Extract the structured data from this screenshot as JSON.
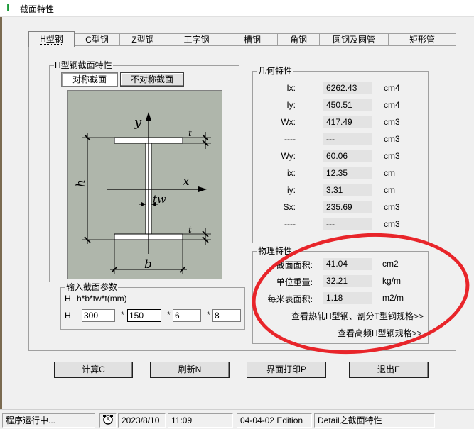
{
  "window": {
    "title": "截面特性",
    "app_icon_glyph": "I"
  },
  "tabs": [
    {
      "label": "H型钢",
      "active": true
    },
    {
      "label": "C型钢"
    },
    {
      "label": "Z型钢"
    },
    {
      "label": "工字钢"
    },
    {
      "label": "槽钢"
    },
    {
      "label": "角钢"
    },
    {
      "label": "圆钢及圆管"
    },
    {
      "label": "矩形管"
    }
  ],
  "h_section": {
    "group_title": "H型钢截面特性",
    "sym_button": "对称截面",
    "asym_button": "不对称截面",
    "figure_labels": {
      "y": "y",
      "x": "x",
      "h": "h",
      "b": "b",
      "t": "t",
      "tw": "tw"
    }
  },
  "input_params": {
    "group_title": "输入截面参数",
    "formula_prefix": "H",
    "formula": "h*b*tw*t(mm)",
    "row_prefix": "H",
    "sep": "*",
    "h": "300",
    "b": "150",
    "tw": "6",
    "t": "8"
  },
  "geometry": {
    "group_title": "几何特性",
    "rows": [
      {
        "label": "Ix:",
        "value": "6262.43",
        "unit": "cm4"
      },
      {
        "label": "Iy:",
        "value": "450.51",
        "unit": "cm4"
      },
      {
        "label": "Wx:",
        "value": "417.49",
        "unit": "cm3"
      },
      {
        "label": "----",
        "value": "---",
        "unit": "cm3"
      },
      {
        "label": "Wy:",
        "value": "60.06",
        "unit": "cm3"
      },
      {
        "label": "ix:",
        "value": "12.35",
        "unit": "cm"
      },
      {
        "label": "iy:",
        "value": "3.31",
        "unit": "cm"
      },
      {
        "label": "Sx:",
        "value": "235.69",
        "unit": "cm3"
      },
      {
        "label": "----",
        "value": "---",
        "unit": "cm3"
      }
    ]
  },
  "physical": {
    "group_title": "物理特性",
    "rows": [
      {
        "label": "截面面积:",
        "value": "41.04",
        "unit": "cm2"
      },
      {
        "label": "单位重量:",
        "value": "32.21",
        "unit": "kg/m"
      },
      {
        "label": "每米表面积:",
        "value": "1.18",
        "unit": "m2/m"
      }
    ],
    "link_hot_rolled": "查看热轧H型钢、剖分T型钢规格>>",
    "link_high_freq": "查看高频H型钢规格>>"
  },
  "actions": {
    "calc": "计算C",
    "refresh": "刷新N",
    "print": "界面打印P",
    "exit": "退出E"
  },
  "status": {
    "running": "程序运行中...",
    "date": "2023/8/10",
    "time": "11:09",
    "edition": "04-04-02 Edition",
    "detail": "Detail之截面特性"
  },
  "colors": {
    "annotation_oval": "#e8252a",
    "drawing_bg": "#afb6ab",
    "app_icon": "#1a9a3a"
  }
}
